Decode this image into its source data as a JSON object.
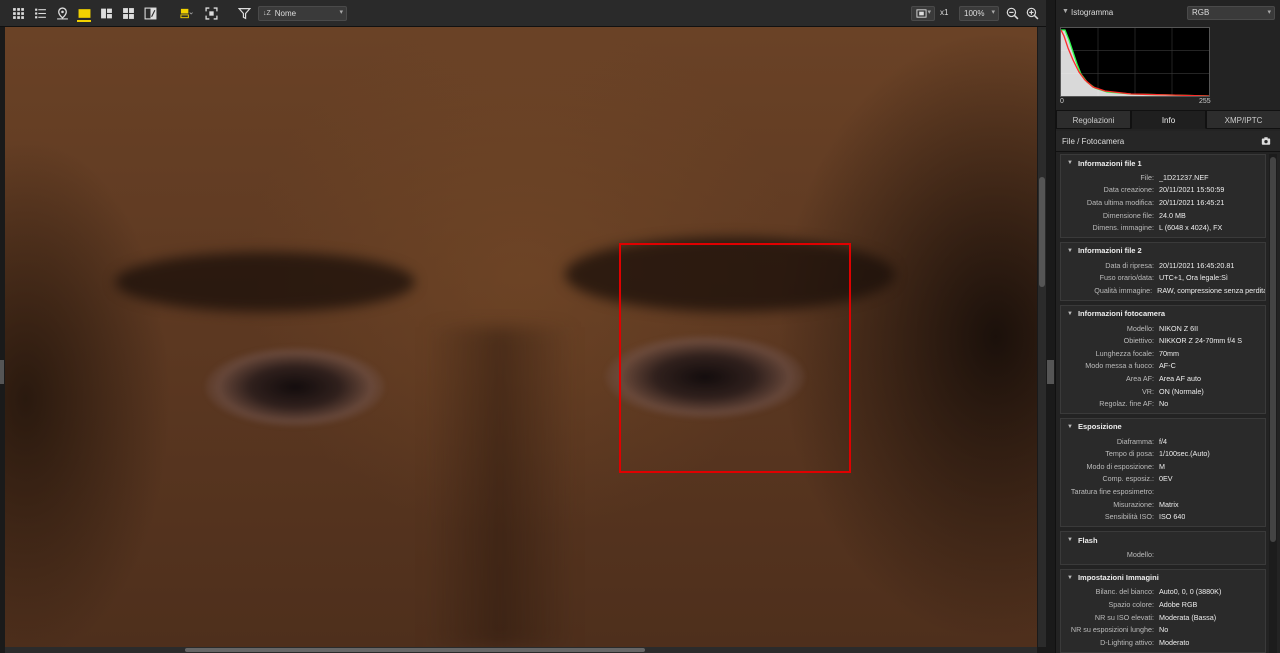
{
  "toolbar": {
    "sort_label": "Nome",
    "sort_prefix": "↓Z",
    "zoom_x": "x1",
    "zoom_level": "100%"
  },
  "panel": {
    "histogram": {
      "title": "Istogramma",
      "channel": "RGB",
      "min_label": "0",
      "max_label": "255"
    },
    "tabs": [
      {
        "label": "Regolazioni"
      },
      {
        "label": "Info"
      },
      {
        "label": "XMP/IPTC"
      }
    ],
    "subheader": "File / Fotocamera",
    "sections": [
      {
        "title": "Informazioni file 1",
        "rows": [
          {
            "k": "File:",
            "v": "_1D21237.NEF"
          },
          {
            "k": "Data creazione:",
            "v": "20/11/2021 15:50:59"
          },
          {
            "k": "Data ultima modifica:",
            "v": "20/11/2021 16:45:21"
          },
          {
            "k": "Dimensione file:",
            "v": "24.0 MB"
          },
          {
            "k": "Dimens. immagine:",
            "v": "L (6048 x 4024), FX"
          }
        ]
      },
      {
        "title": "Informazioni file 2",
        "rows": [
          {
            "k": "Data di ripresa:",
            "v": "20/11/2021 16:45:20.81"
          },
          {
            "k": "Fuso orario/data:",
            "v": "UTC+1, Ora legale:Sì"
          },
          {
            "k": "Qualità immagine:",
            "v": "RAW, compressione senza perdita"
          }
        ]
      },
      {
        "title": "Informazioni fotocamera",
        "rows": [
          {
            "k": "Modello:",
            "v": "NIKON Z 6II"
          },
          {
            "k": "Obiettivo:",
            "v": "NIKKOR Z 24-70mm f/4 S"
          },
          {
            "k": "Lunghezza focale:",
            "v": "70mm"
          },
          {
            "k": "Modo messa a fuoco:",
            "v": "AF-C"
          },
          {
            "k": "Area AF:",
            "v": "Area AF auto"
          },
          {
            "k": "VR:",
            "v": "ON (Normale)"
          },
          {
            "k": "Regolaz. fine AF:",
            "v": "No"
          }
        ]
      },
      {
        "title": "Esposizione",
        "rows": [
          {
            "k": "Diaframma:",
            "v": "f/4"
          },
          {
            "k": "Tempo di posa:",
            "v": "1/100sec.(Auto)"
          },
          {
            "k": "Modo di esposizione:",
            "v": "M"
          },
          {
            "k": "Comp. esposiz.:",
            "v": "0EV"
          },
          {
            "k": "Taratura fine esposimetro:",
            "v": ""
          },
          {
            "k": "Misurazione:",
            "v": "Matrix"
          },
          {
            "k": "Sensibilità ISO:",
            "v": "ISO 640"
          }
        ]
      },
      {
        "title": "Flash",
        "rows": [
          {
            "k": "Modello:",
            "v": ""
          }
        ]
      },
      {
        "title": "Impostazioni Immagini",
        "rows": [
          {
            "k": "Bilanc. del bianco:",
            "v": "Auto0, 0, 0 (3880K)"
          },
          {
            "k": "Spazio colore:",
            "v": "Adobe RGB"
          },
          {
            "k": "NR su ISO elevati:",
            "v": "Moderata (Bassa)"
          },
          {
            "k": "NR su esposizioni lunghe:",
            "v": "No"
          },
          {
            "k": "D-Lighting attivo:",
            "v": "Moderato"
          }
        ]
      }
    ]
  },
  "colors": {
    "accent_yellow": "#f2d200",
    "focus_box": "#e00000",
    "histogram_red": "#ff2a2a",
    "histogram_green": "#2aff4a"
  }
}
